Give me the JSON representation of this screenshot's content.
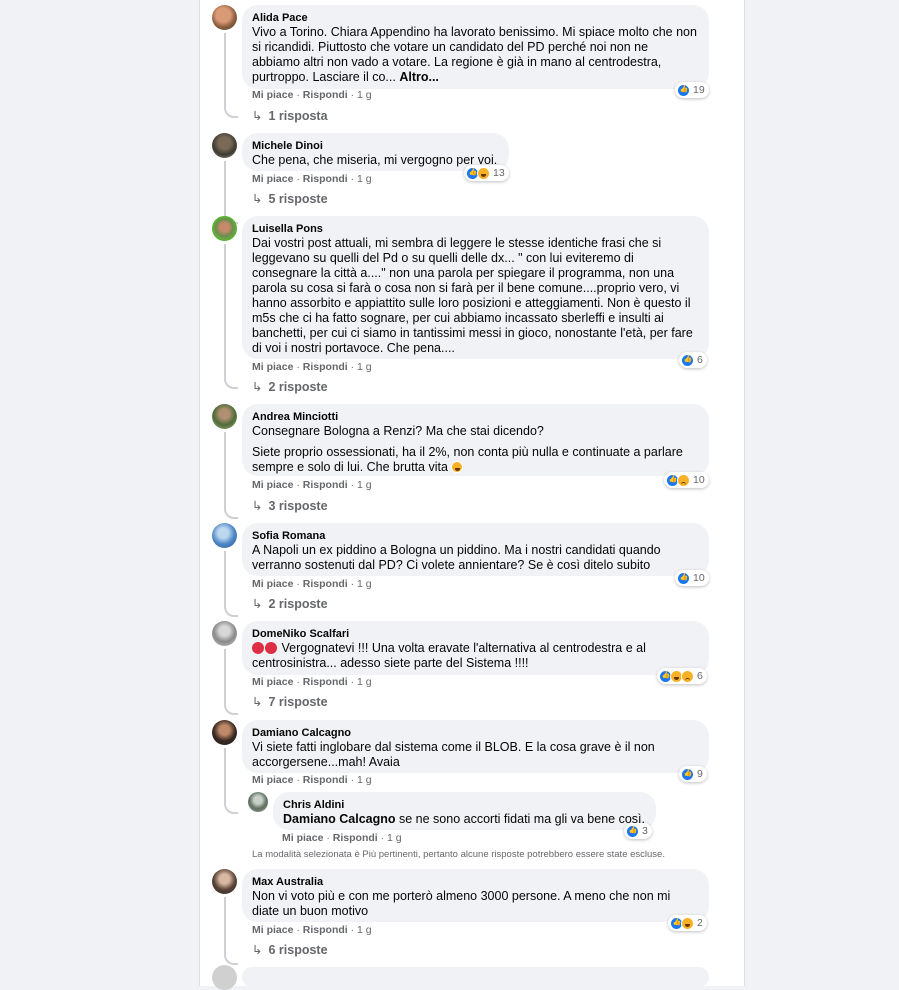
{
  "labels": {
    "like": "Mi piace",
    "reply": "Rispondi",
    "sep": "·"
  },
  "comments": [
    {
      "author": "Alida Pace",
      "text": "Vivo a Torino. Chiara Appendino ha lavorato benissimo. Mi spiace molto che non si ricandidi. Piuttosto che votare un candidato del PD perché noi non ne abbiamo altri non vado a votare. La regione è già in mano al centrodestra, purtroppo. Lasciare il co...",
      "more": "Altro...",
      "time": "1 g",
      "reactions": "19",
      "replies": "1 risposta"
    },
    {
      "author": "Michele Dinoi",
      "text": "Che pena, che miseria, mi vergogno per voi.",
      "time": "1 g",
      "reactions": "13",
      "replies": "5 risposte"
    },
    {
      "author": "Luisella Pons",
      "text": "Dai vostri post attuali, mi sembra di leggere le stesse identiche frasi che si leggevano su quelli del Pd o su quelli delle dx... \" con lui eviteremo di consegnare la città a....\" non una parola per spiegare il programma, non una parola su cosa si farà o cosa non si farà per il bene comune....proprio vero, vi hanno assorbito e appiattito sulle loro posizioni e atteggiamenti. Non è questo il m5s che ci ha fatto sognare, per cui abbiamo incassato sberleffi e insulti ai banchetti, per cui ci siamo in tantissimi messi in gioco, nonostante l'età, per fare di voi i nostri portavoce. Che pena....",
      "time": "1 g",
      "reactions": "6",
      "replies": "2 risposte"
    },
    {
      "author": "Andrea Minciotti",
      "text": "Consegnare Bologna a Renzi? Ma che stai dicendo?",
      "text2": "Siete proprio ossessionati, ha il 2%, non conta più nulla e continuate a parlare sempre e solo di lui. Che brutta vita",
      "time": "1 g",
      "reactions": "10",
      "replies": "3 risposte"
    },
    {
      "author": "Sofia Romana",
      "text": "A Napoli un ex piddino a Bologna un piddino. Ma i nostri candidati quando verranno sostenuti dal PD? Ci volete annientare? Se è così ditelo subito",
      "time": "1 g",
      "reactions": "10",
      "replies": "2 risposte"
    },
    {
      "author": "DomeNiko Scalfari",
      "text": "Vergognatevi !!! Una volta eravate l'alternativa al centrodestra e al centrosinistra... adesso siete parte del Sistema !!!!",
      "time": "1 g",
      "reactions": "6",
      "replies": "7 risposte"
    },
    {
      "author": "Damiano Calcagno",
      "text": "Vi siete fatti inglobare dal sistema come il BLOB. E la cosa grave è il non accorgersene...mah! Avaia",
      "time": "1 g",
      "reactions": "9"
    },
    {
      "author": "Max Australia",
      "text": "Non vi voto più e con me porterò almeno 3000 persone. A meno che non mi diate un buon motivo",
      "time": "1 g",
      "reactions": "2",
      "replies": "6 risposte"
    }
  ],
  "reply": {
    "author": "Chris Aldini",
    "mention": "Damiano Calcagno",
    "text": " se ne sono accorti fidati ma gli va bene così.",
    "time": "1 g",
    "reactions": "3"
  },
  "notice": "La modalità selezionata è Più pertinenti, pertanto alcune risposte potrebbero essere state escluse.",
  "colors": {
    "like": "#1877f2",
    "bubble": "#f0f2f5",
    "meta": "#65676b"
  }
}
